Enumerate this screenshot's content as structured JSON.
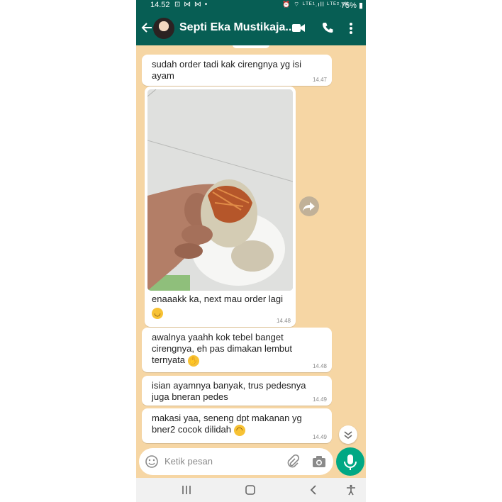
{
  "status_bar": {
    "time": "14.52",
    "left_icons": "⊡ ⋈ ⋈ •",
    "right_icons": "⏰ ⌔ ᴸᵀᴱ¹.ıll ᴸᵀᴱ².ıll",
    "battery": "75%"
  },
  "header": {
    "contact_name": "Septi Eka Mustikaja...",
    "icons": [
      "back-arrow-icon",
      "avatar",
      "video-call-icon",
      "phone-icon",
      "more-vert-icon"
    ]
  },
  "theme": {
    "header_color": "#075e54",
    "chat_background": "#f6d6a4",
    "bubble_color": "#ffffff",
    "mic_button_color": "#00a884"
  },
  "messages": [
    {
      "line1": "sudah order tadi kak cirengnya yg isi",
      "line2": "ayam",
      "time": "14.47"
    },
    {
      "type": "image",
      "caption_line1": "enaaakk ka, next mau order lagi",
      "emoji": "😊",
      "time": "14.48"
    },
    {
      "line1": "awalnya yaahh kok tebel banget",
      "line2": "cirengnya, eh pas dimakan lembut",
      "line3": "ternyata",
      "emoji": "🤭",
      "time": "14.48"
    },
    {
      "line1": "isian ayamnya banyak, trus pedesnya",
      "line2": "juga bneran pedes",
      "time": "14.49"
    },
    {
      "line1": "makasi yaa, seneng dpt makanan yg",
      "line2": "bner2 cocok dilidah",
      "emoji": "😁",
      "time": "14.49"
    }
  ],
  "input": {
    "placeholder": "Ketik pesan"
  },
  "nav_bar": {
    "icons": [
      "recents-icon",
      "home-icon",
      "back-icon",
      "accessibility-icon"
    ]
  }
}
